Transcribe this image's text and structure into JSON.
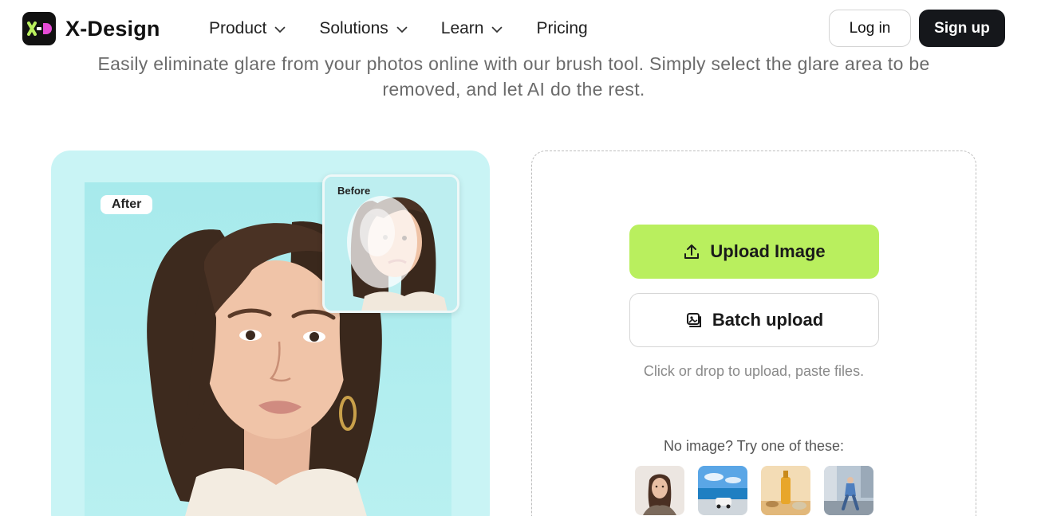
{
  "brand": {
    "name": "X-Design",
    "logo_icon": "x-d-logo-icon"
  },
  "nav": {
    "items": [
      {
        "label": "Product",
        "has_dropdown": true
      },
      {
        "label": "Solutions",
        "has_dropdown": true
      },
      {
        "label": "Learn",
        "has_dropdown": true
      },
      {
        "label": "Pricing",
        "has_dropdown": false
      }
    ],
    "login_label": "Log in",
    "signup_label": "Sign up"
  },
  "hero": {
    "description": "Easily eliminate glare from your photos online with our brush tool. Simply select the glare area to be removed, and let AI do the rest."
  },
  "showcase": {
    "after_label": "After",
    "before_label": "Before"
  },
  "upload": {
    "upload_label": "Upload Image",
    "upload_icon": "upload-icon",
    "batch_label": "Batch upload",
    "batch_icon": "batch-images-icon",
    "hint": "Click or drop to upload, paste files.",
    "samples_heading": "No image? Try one of these:",
    "samples": [
      {
        "name": "sample-portrait"
      },
      {
        "name": "sample-car-beach"
      },
      {
        "name": "sample-product-bottle"
      },
      {
        "name": "sample-street-woman"
      }
    ]
  },
  "colors": {
    "accent": "#b9ef5e",
    "dark": "#15171b",
    "showcase_bg": "#c9f4f5",
    "muted_text": "#6b6b6b"
  }
}
